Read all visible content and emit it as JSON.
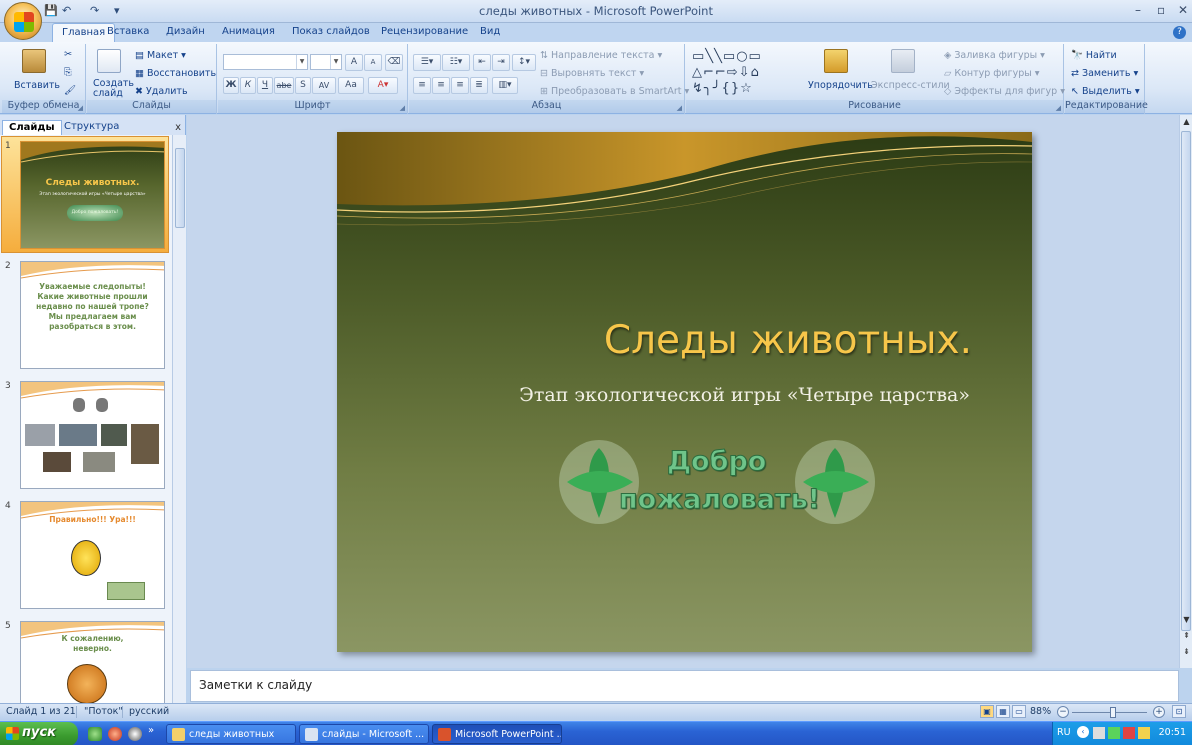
{
  "window": {
    "title": "следы животных - Microsoft PowerPoint"
  },
  "qat": {
    "save": "💾",
    "undo": "↶",
    "redo": "↷",
    "customize": "▾"
  },
  "tabs": [
    "Главная",
    "Вставка",
    "Дизайн",
    "Анимация",
    "Показ слайдов",
    "Рецензирование",
    "Вид"
  ],
  "ribbon": {
    "clipboard": {
      "paste": "Вставить",
      "label": "Буфер обмена"
    },
    "slides": {
      "new_slide": "Создать слайд",
      "layout": "Макет",
      "reset": "Восстановить",
      "delete": "Удалить",
      "label": "Слайды"
    },
    "font": {
      "label": "Шрифт",
      "bold": "Ж",
      "italic": "К",
      "underline": "Ч",
      "strike": "abe",
      "shadow": "S",
      "spacing": "AV",
      "case": "Aa",
      "grow": "A",
      "shrink": "A"
    },
    "paragraph": {
      "text_direction": "Направление текста",
      "align_text": "Выровнять текст",
      "smartart": "Преобразовать в SmartArt",
      "label": "Абзац"
    },
    "drawing": {
      "arrange": "Упорядочить",
      "quick_styles": "Экспресс-стили",
      "fill": "Заливка фигуры",
      "outline": "Контур фигуры",
      "effects": "Эффекты для фигур",
      "label": "Рисование"
    },
    "editing": {
      "find": "Найти",
      "replace": "Заменить",
      "select": "Выделить",
      "label": "Редактирование"
    }
  },
  "left_panel": {
    "tabs": [
      "Слайды",
      "Структура"
    ],
    "close": "x",
    "thumbs": [
      {
        "num": "1",
        "title": "Следы животных.",
        "sub": "Этап экологической игры «Четыре царства»",
        "badge": "Добро пожаловать!"
      },
      {
        "num": "2",
        "text": "Уважаемые следопыты! Какие животные прошли недавно по нашей тропе? Мы предлагаем вам разобраться в этом."
      },
      {
        "num": "3"
      },
      {
        "num": "4",
        "text": "Правильно!!! Ура!!!"
      },
      {
        "num": "5",
        "text": "К сожалению, неверно."
      }
    ]
  },
  "slide": {
    "title": "Следы животных.",
    "subtitle": "Этап экологической игры «Четыре царства»",
    "welcome_line1": "Добро",
    "welcome_line2": "пожаловать!"
  },
  "notes": {
    "placeholder": "Заметки к слайду"
  },
  "status": {
    "slide_of": "Слайд 1 из 21",
    "theme": "\"Поток\"",
    "language": "русский",
    "zoom": "88%",
    "zoom_fraction": 0.55
  },
  "taskbar": {
    "start": "пуск",
    "tasks": [
      "следы животных",
      "слайды - Microsoft ...",
      "Microsoft PowerPoint ..."
    ],
    "lang": "RU",
    "clock": "20:51"
  },
  "colors": {
    "slide_title": "#f7c64a",
    "accent_blue": "#15428b",
    "welcome_green": "#6fc48a"
  }
}
